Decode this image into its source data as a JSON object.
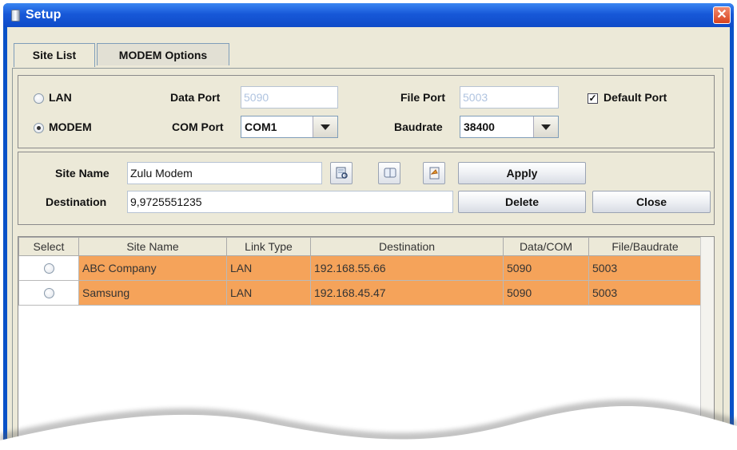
{
  "window": {
    "title": "Setup",
    "close_glyph": "✕"
  },
  "tabs": [
    {
      "label": "Site List"
    },
    {
      "label": "MODEM Options"
    }
  ],
  "connection": {
    "lan_label": "LAN",
    "modem_label": "MODEM",
    "selected": "MODEM",
    "data_port_label": "Data Port",
    "data_port_value": "5090",
    "file_port_label": "File Port",
    "file_port_value": "5003",
    "default_port_label": "Default Port",
    "default_port_checked": true,
    "com_port_label": "COM Port",
    "com_port_value": "COM1",
    "baudrate_label": "Baudrate",
    "baudrate_value": "38400"
  },
  "site": {
    "name_label": "Site Name",
    "name_value": "Zulu Modem",
    "destination_label": "Destination",
    "destination_value": "9,9725551235",
    "apply_label": "Apply",
    "delete_label": "Delete",
    "close_label": "Close",
    "icons": [
      "find-icon",
      "phonebook-icon",
      "dialer-icon"
    ]
  },
  "table": {
    "columns": [
      "Select",
      "Site Name",
      "Link Type",
      "Destination",
      "Data/COM",
      "File/Baudrate"
    ],
    "rows": [
      {
        "site_name": "ABC Company",
        "link_type": "LAN",
        "destination": "192.168.55.66",
        "data_com": "5090",
        "file_baudrate": "5003"
      },
      {
        "site_name": "Samsung",
        "link_type": "LAN",
        "destination": "192.168.45.47",
        "data_com": "5090",
        "file_baudrate": "5003"
      }
    ]
  },
  "colors": {
    "title_bar": "#1758d8",
    "row_highlight": "#f5a35a",
    "panel": "#ece9d8"
  }
}
